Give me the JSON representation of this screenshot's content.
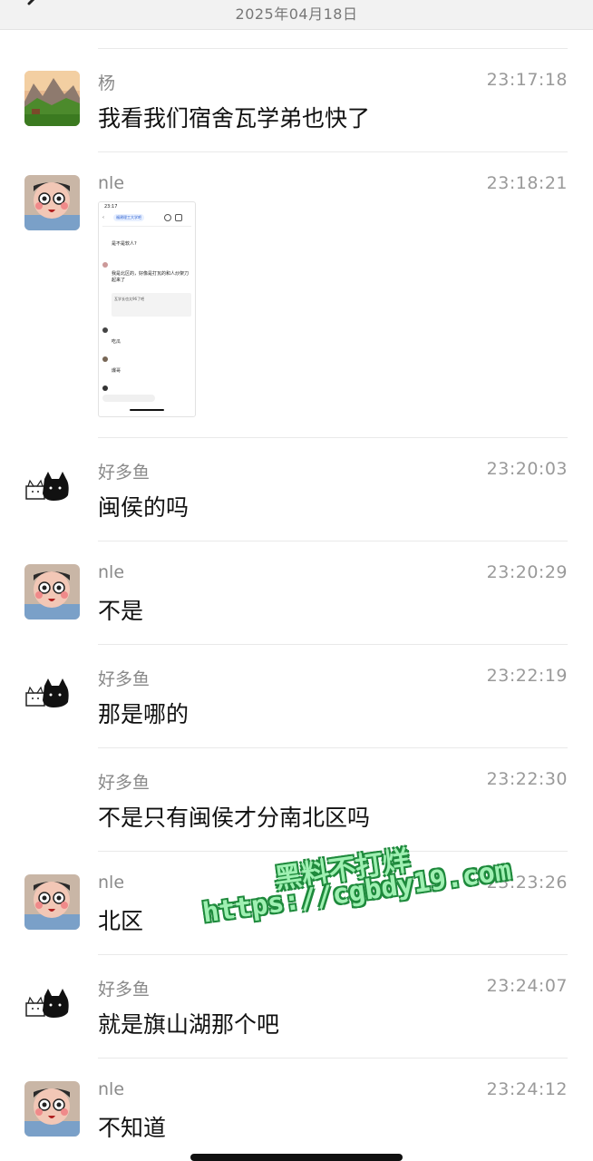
{
  "header": {
    "date": "2025年04月18日"
  },
  "messages": [
    {
      "sender": "杨",
      "time": "23:17:18",
      "text": "我看我们宿舍瓦学弟也快了",
      "avatar": "landscape"
    },
    {
      "sender": "nle",
      "time": "23:18:21",
      "text": "",
      "avatar": "cartoon",
      "image": {
        "status_time": "23:17",
        "group_name": "福建理工大学吧",
        "line1": "是不是软人?",
        "line2": "我是北区的，好像是打瓦的和人炒架刀起来了",
        "line3": "瓦学长也太96了吧",
        "line4": "吃瓜",
        "line5": "爆哥"
      }
    },
    {
      "sender": "好多鱼",
      "time": "23:20:03",
      "text": "闽侯的吗",
      "avatar": "cat"
    },
    {
      "sender": "nle",
      "time": "23:20:29",
      "text": "不是",
      "avatar": "cartoon"
    },
    {
      "sender": "好多鱼",
      "time": "23:22:19",
      "text": "那是哪的",
      "avatar": "cat"
    },
    {
      "sender": "好多鱼",
      "time": "23:22:30",
      "text": "不是只有闽侯才分南北区吗",
      "avatar": "none"
    },
    {
      "sender": "nle",
      "time": "23:23:26",
      "text": "北区",
      "avatar": "cartoon"
    },
    {
      "sender": "好多鱼",
      "time": "23:24:07",
      "text": "就是旗山湖那个吧",
      "avatar": "cat"
    },
    {
      "sender": "nle",
      "time": "23:24:12",
      "text": "不知道",
      "avatar": "cartoon"
    }
  ],
  "watermark": {
    "line1": "黑料不打烊",
    "line2": "https://cgbdy19.com"
  }
}
